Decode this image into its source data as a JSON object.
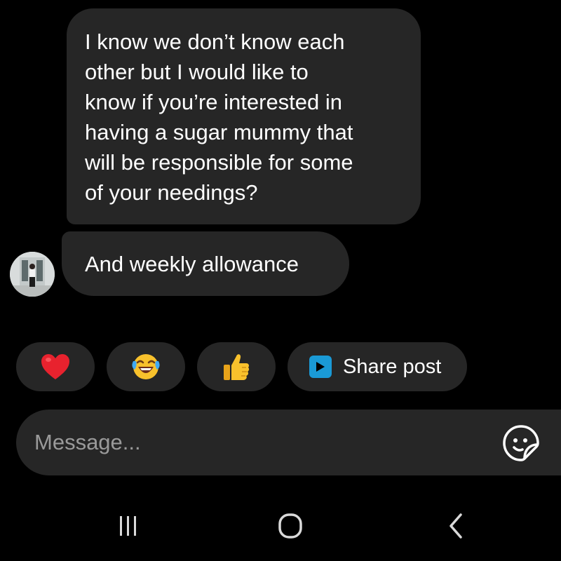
{
  "messages": [
    {
      "lines": [
        "I know we don’t know each",
        "other but I would like to",
        "know if you’re interested in",
        "having a sugar mummy that",
        "will be responsible for some",
        "of your needings?"
      ]
    },
    {
      "lines": [
        "And weekly allowance"
      ]
    }
  ],
  "reactions": [
    {
      "icon": "red-heart-icon",
      "glyph": "❤️"
    },
    {
      "icon": "tears-of-joy-emoji-icon",
      "glyph": "😂"
    },
    {
      "icon": "thumbs-up-emoji-icon",
      "glyph": "👍"
    }
  ],
  "share": {
    "label": "Share post",
    "icon": "share-post-icon"
  },
  "composer": {
    "placeholder": "Message...",
    "sticker_icon": "sticker-icon"
  },
  "navbar": {
    "recent_icon": "recent-apps-icon",
    "home_icon": "home-icon",
    "back_icon": "back-icon"
  },
  "colors": {
    "background": "#000000",
    "bubble": "#262626",
    "text": "#ffffff",
    "placeholder": "#9a9a9a",
    "share_icon": "#1a9ad6",
    "heart": "#e8222e"
  }
}
